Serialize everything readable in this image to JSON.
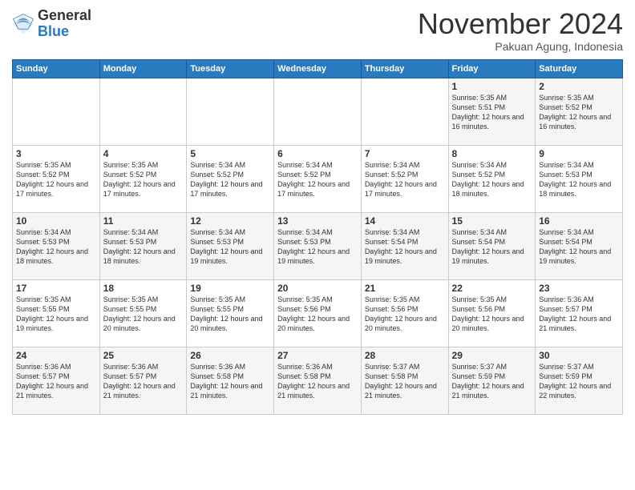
{
  "header": {
    "logo": {
      "line1": "General",
      "line2": "Blue"
    },
    "title": "November 2024",
    "subtitle": "Pakuan Agung, Indonesia"
  },
  "weekdays": [
    "Sunday",
    "Monday",
    "Tuesday",
    "Wednesday",
    "Thursday",
    "Friday",
    "Saturday"
  ],
  "weeks": [
    [
      {
        "day": "",
        "info": ""
      },
      {
        "day": "",
        "info": ""
      },
      {
        "day": "",
        "info": ""
      },
      {
        "day": "",
        "info": ""
      },
      {
        "day": "",
        "info": ""
      },
      {
        "day": "1",
        "info": "Sunrise: 5:35 AM\nSunset: 5:51 PM\nDaylight: 12 hours and 16 minutes."
      },
      {
        "day": "2",
        "info": "Sunrise: 5:35 AM\nSunset: 5:52 PM\nDaylight: 12 hours and 16 minutes."
      }
    ],
    [
      {
        "day": "3",
        "info": "Sunrise: 5:35 AM\nSunset: 5:52 PM\nDaylight: 12 hours and 17 minutes."
      },
      {
        "day": "4",
        "info": "Sunrise: 5:35 AM\nSunset: 5:52 PM\nDaylight: 12 hours and 17 minutes."
      },
      {
        "day": "5",
        "info": "Sunrise: 5:34 AM\nSunset: 5:52 PM\nDaylight: 12 hours and 17 minutes."
      },
      {
        "day": "6",
        "info": "Sunrise: 5:34 AM\nSunset: 5:52 PM\nDaylight: 12 hours and 17 minutes."
      },
      {
        "day": "7",
        "info": "Sunrise: 5:34 AM\nSunset: 5:52 PM\nDaylight: 12 hours and 17 minutes."
      },
      {
        "day": "8",
        "info": "Sunrise: 5:34 AM\nSunset: 5:52 PM\nDaylight: 12 hours and 18 minutes."
      },
      {
        "day": "9",
        "info": "Sunrise: 5:34 AM\nSunset: 5:53 PM\nDaylight: 12 hours and 18 minutes."
      }
    ],
    [
      {
        "day": "10",
        "info": "Sunrise: 5:34 AM\nSunset: 5:53 PM\nDaylight: 12 hours and 18 minutes."
      },
      {
        "day": "11",
        "info": "Sunrise: 5:34 AM\nSunset: 5:53 PM\nDaylight: 12 hours and 18 minutes."
      },
      {
        "day": "12",
        "info": "Sunrise: 5:34 AM\nSunset: 5:53 PM\nDaylight: 12 hours and 19 minutes."
      },
      {
        "day": "13",
        "info": "Sunrise: 5:34 AM\nSunset: 5:53 PM\nDaylight: 12 hours and 19 minutes."
      },
      {
        "day": "14",
        "info": "Sunrise: 5:34 AM\nSunset: 5:54 PM\nDaylight: 12 hours and 19 minutes."
      },
      {
        "day": "15",
        "info": "Sunrise: 5:34 AM\nSunset: 5:54 PM\nDaylight: 12 hours and 19 minutes."
      },
      {
        "day": "16",
        "info": "Sunrise: 5:34 AM\nSunset: 5:54 PM\nDaylight: 12 hours and 19 minutes."
      }
    ],
    [
      {
        "day": "17",
        "info": "Sunrise: 5:35 AM\nSunset: 5:55 PM\nDaylight: 12 hours and 19 minutes."
      },
      {
        "day": "18",
        "info": "Sunrise: 5:35 AM\nSunset: 5:55 PM\nDaylight: 12 hours and 20 minutes."
      },
      {
        "day": "19",
        "info": "Sunrise: 5:35 AM\nSunset: 5:55 PM\nDaylight: 12 hours and 20 minutes."
      },
      {
        "day": "20",
        "info": "Sunrise: 5:35 AM\nSunset: 5:56 PM\nDaylight: 12 hours and 20 minutes."
      },
      {
        "day": "21",
        "info": "Sunrise: 5:35 AM\nSunset: 5:56 PM\nDaylight: 12 hours and 20 minutes."
      },
      {
        "day": "22",
        "info": "Sunrise: 5:35 AM\nSunset: 5:56 PM\nDaylight: 12 hours and 20 minutes."
      },
      {
        "day": "23",
        "info": "Sunrise: 5:36 AM\nSunset: 5:57 PM\nDaylight: 12 hours and 21 minutes."
      }
    ],
    [
      {
        "day": "24",
        "info": "Sunrise: 5:36 AM\nSunset: 5:57 PM\nDaylight: 12 hours and 21 minutes."
      },
      {
        "day": "25",
        "info": "Sunrise: 5:36 AM\nSunset: 5:57 PM\nDaylight: 12 hours and 21 minutes."
      },
      {
        "day": "26",
        "info": "Sunrise: 5:36 AM\nSunset: 5:58 PM\nDaylight: 12 hours and 21 minutes."
      },
      {
        "day": "27",
        "info": "Sunrise: 5:36 AM\nSunset: 5:58 PM\nDaylight: 12 hours and 21 minutes."
      },
      {
        "day": "28",
        "info": "Sunrise: 5:37 AM\nSunset: 5:58 PM\nDaylight: 12 hours and 21 minutes."
      },
      {
        "day": "29",
        "info": "Sunrise: 5:37 AM\nSunset: 5:59 PM\nDaylight: 12 hours and 21 minutes."
      },
      {
        "day": "30",
        "info": "Sunrise: 5:37 AM\nSunset: 5:59 PM\nDaylight: 12 hours and 22 minutes."
      }
    ]
  ]
}
